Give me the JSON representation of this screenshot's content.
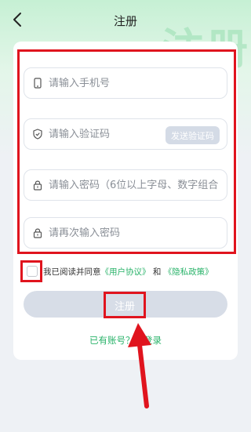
{
  "header": {
    "title": "注册",
    "watermark": "注册"
  },
  "form": {
    "phone_placeholder": "请输入手机号",
    "code_placeholder": "请输入验证码",
    "send_code_label": "发送验证码",
    "password_placeholder": "请输入密码（6位以上字母、数字组合",
    "password_confirm_placeholder": "请再次输入密码"
  },
  "agreement": {
    "prefix": "我已阅读并同意",
    "user_agreement": "《用户协议》",
    "and": " 和 ",
    "privacy_policy": "《隐私政策》"
  },
  "register_button_label": "注册",
  "login_link_label": "已有账号？去登录",
  "colors": {
    "accent": "#2ab36a",
    "highlight": "#e0141e",
    "button_disabled": "#d7dde7"
  }
}
